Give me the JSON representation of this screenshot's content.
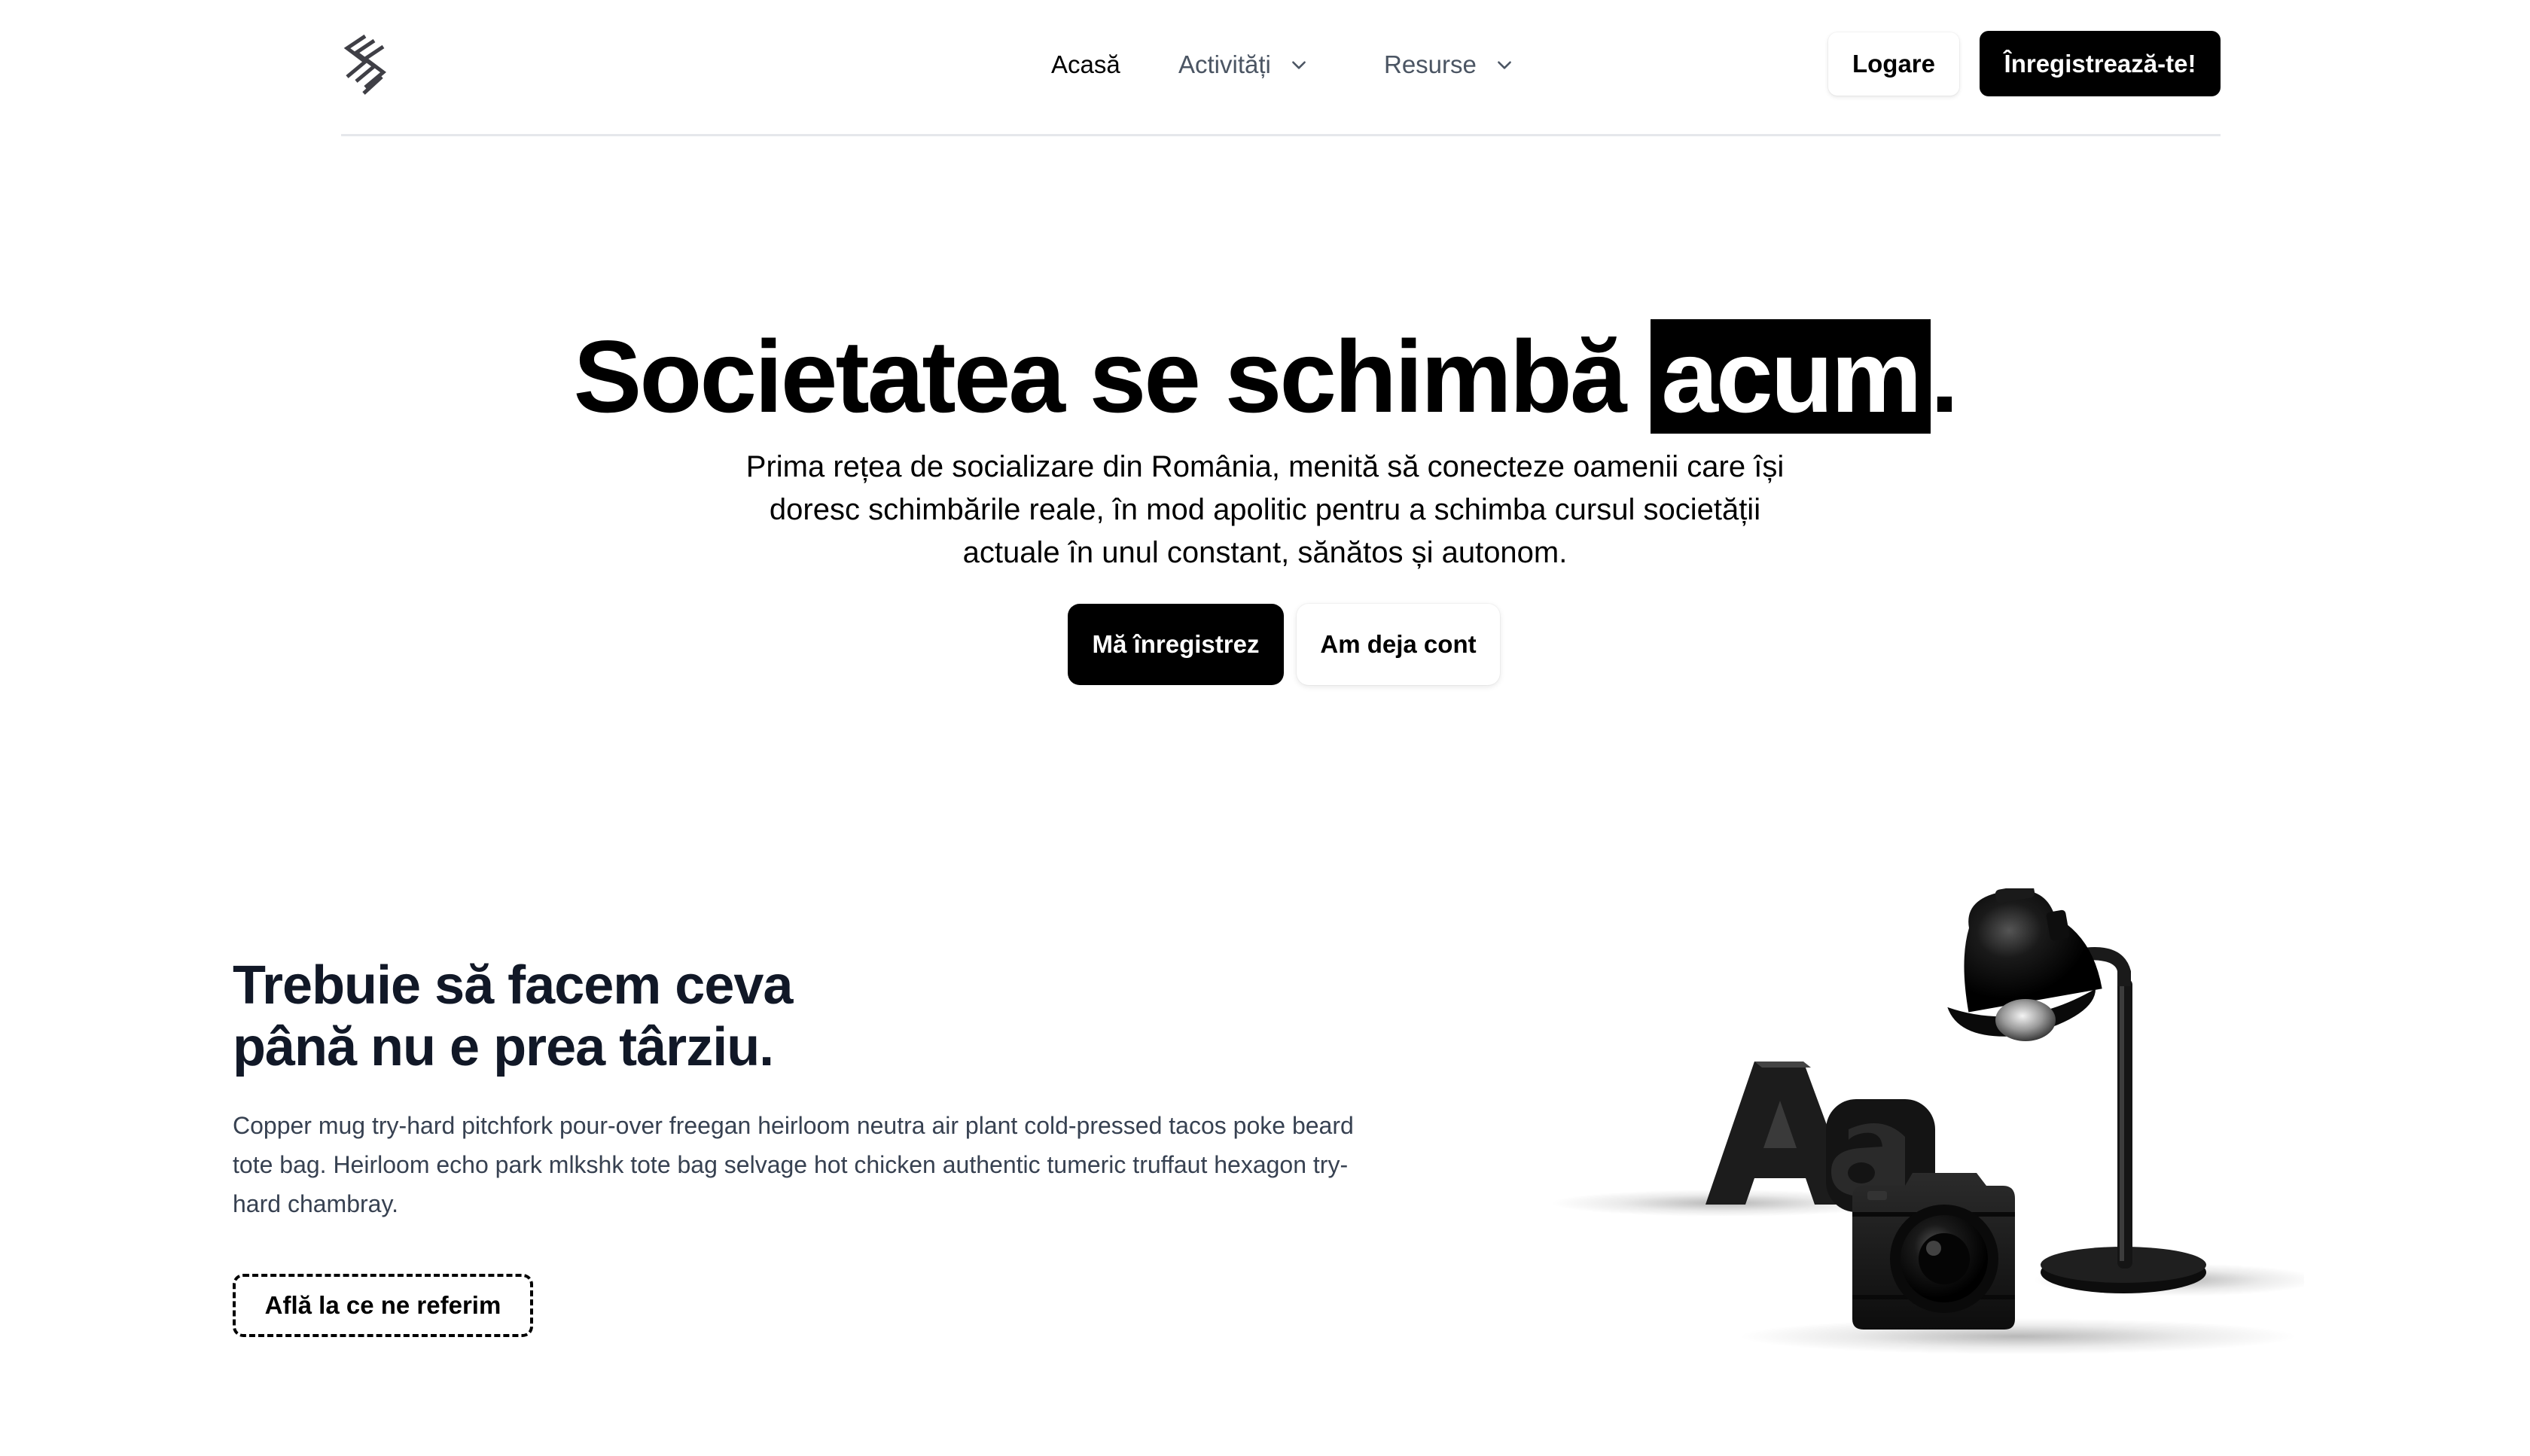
{
  "header": {
    "logo_icon": "s-brand-logo-icon",
    "nav": [
      {
        "label": "Acasă",
        "has_dropdown": false,
        "active": true
      },
      {
        "label": "Activități",
        "has_dropdown": true,
        "active": false
      },
      {
        "label": "Resurse",
        "has_dropdown": true,
        "active": false
      }
    ],
    "login_label": "Logare",
    "signup_label": "Înregistrează-te!"
  },
  "hero": {
    "title_main": "Societatea se schimbă ",
    "title_highlight": "acum",
    "title_end": ".",
    "subtitle": "Prima rețea de socializare din România, menită să conecteze oamenii care își doresc schimbările reale, în mod apolitic pentru a schimba cursul societății actuale în unul constant, sănătos și autonom.",
    "primary_button": "Mă înregistrez",
    "secondary_button": "Am deja cont"
  },
  "feature": {
    "title_line1": "Trebuie să facem ceva",
    "title_line2": "până nu e prea târziu.",
    "text": "Copper mug try-hard pitchfork pour-over freegan heirloom neutra air plant cold-pressed tacos poke beard tote bag. Heirloom echo park mlkshk tote bag selvage hot chicken authentic tumeric truffaut hexagon try-hard chambray.",
    "cta_label": "Află la ce ne referim",
    "illustration_icons": [
      "typography-aa-icon",
      "camera-icon",
      "desk-lamp-icon"
    ]
  },
  "colors": {
    "primary": "#000000",
    "background": "#ffffff",
    "text_muted": "#4b5563",
    "body_text": "#374151",
    "divider": "#e5e7eb"
  }
}
